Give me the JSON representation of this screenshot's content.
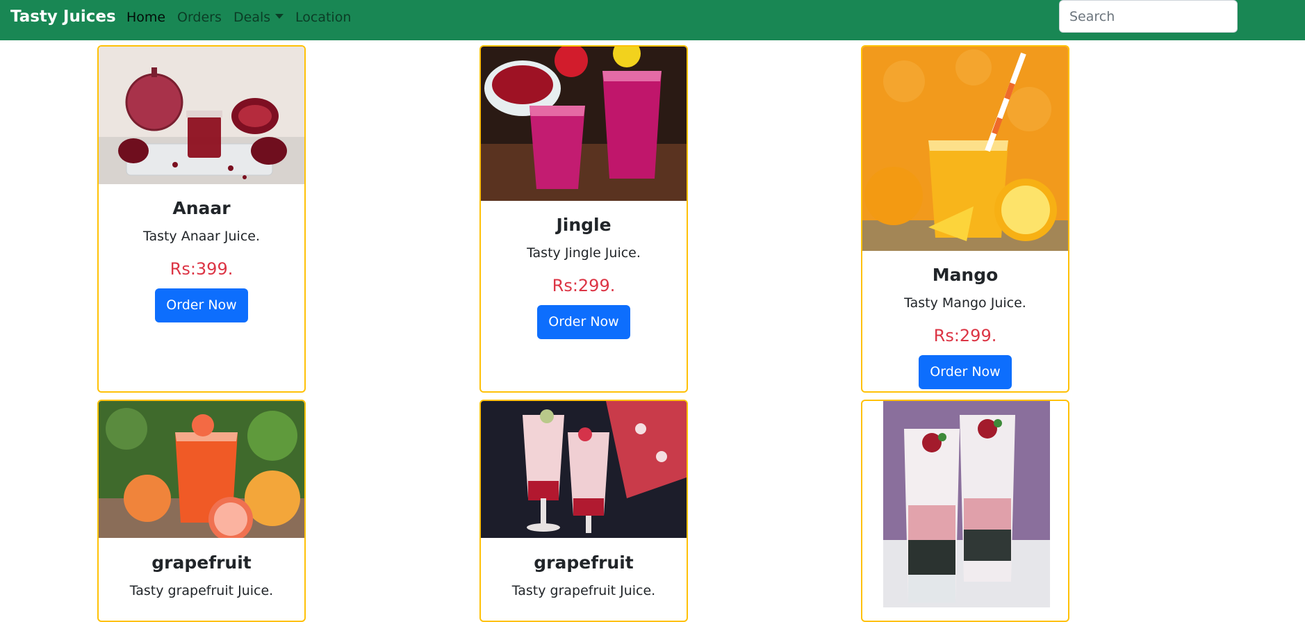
{
  "navbar": {
    "brand": "Tasty Juices",
    "links": [
      "Home",
      "Orders",
      "Deals",
      "Location"
    ],
    "search_placeholder": "Search"
  },
  "colors": {
    "navbar": "#198754",
    "card_border": "#ffc107",
    "price": "#dc3545",
    "button": "#0d6efd"
  },
  "cards": [
    {
      "title": "Anaar",
      "text": "Tasty Anaar Juice.",
      "price": "Rs:399.",
      "button": "Order Now",
      "image": "pomegranate-juice-photo"
    },
    {
      "title": "Jingle",
      "text": "Tasty Jingle Juice.",
      "price": "Rs:299.",
      "button": "Order Now",
      "image": "pink-smoothie-photo"
    },
    {
      "title": "Mango",
      "text": "Tasty Mango Juice.",
      "price": "Rs:299.",
      "button": "Order Now",
      "image": "orange-juice-photo"
    },
    {
      "title": "grapefruit",
      "text": "Tasty grapefruit Juice.",
      "image": "grapefruit-juice-photo"
    },
    {
      "title": "grapefruit",
      "text": "Tasty grapefruit Juice.",
      "image": "falooda-glasses-photo"
    },
    {
      "image": "falooda-layered-glasses-photo"
    }
  ]
}
